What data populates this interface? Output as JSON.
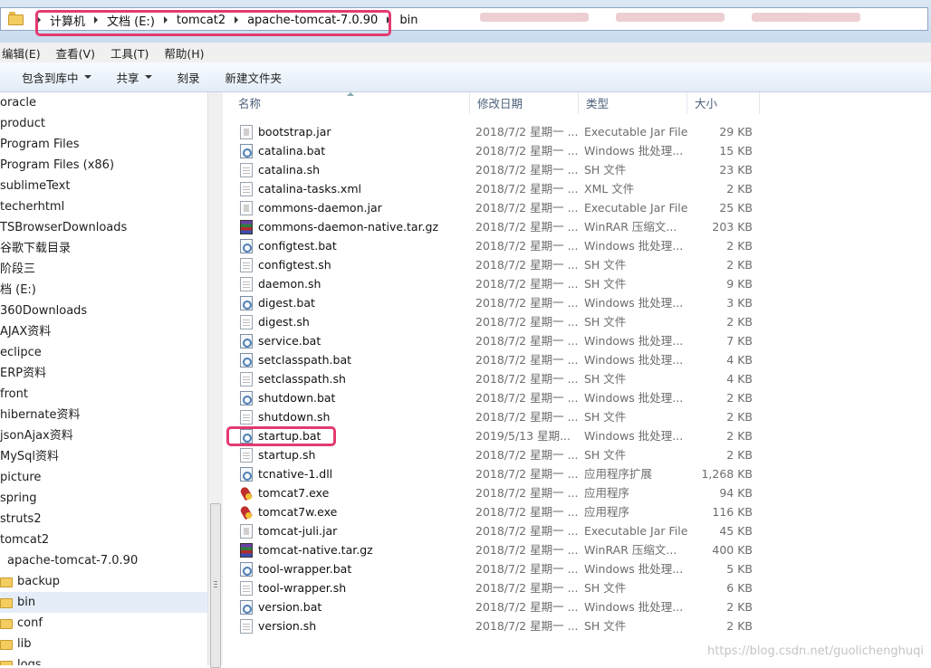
{
  "address": {
    "crumbs": [
      "计算机",
      "文档 (E:)",
      "tomcat2",
      "apache-tomcat-7.0.90",
      "bin"
    ]
  },
  "menu": [
    "编辑(E)",
    "查看(V)",
    "工具(T)",
    "帮助(H)"
  ],
  "toolbar": {
    "include_library": "包含到库中",
    "share": "共享",
    "burn": "刻录",
    "new_folder": "新建文件夹"
  },
  "nav": [
    {
      "label": "oracle",
      "indent": 0,
      "folder": false
    },
    {
      "label": "product",
      "indent": 0,
      "folder": false
    },
    {
      "label": "Program Files",
      "indent": 0,
      "folder": false
    },
    {
      "label": "Program Files (x86)",
      "indent": 0,
      "folder": false
    },
    {
      "label": "sublimeText",
      "indent": 0,
      "folder": false
    },
    {
      "label": "techerhtml",
      "indent": 0,
      "folder": false
    },
    {
      "label": "TSBrowserDownloads",
      "indent": 0,
      "folder": false
    },
    {
      "label": "谷歌下载目录",
      "indent": 0,
      "folder": false
    },
    {
      "label": "阶段三",
      "indent": 0,
      "folder": false
    },
    {
      "label": "档 (E:)",
      "indent": 0,
      "folder": false
    },
    {
      "label": "360Downloads",
      "indent": 0,
      "folder": false
    },
    {
      "label": "AJAX资料",
      "indent": 0,
      "folder": false
    },
    {
      "label": "eclipce",
      "indent": 0,
      "folder": false
    },
    {
      "label": "ERP资料",
      "indent": 0,
      "folder": false
    },
    {
      "label": "front",
      "indent": 0,
      "folder": false
    },
    {
      "label": "hibernate资料",
      "indent": 0,
      "folder": false
    },
    {
      "label": "jsonAjax资料",
      "indent": 0,
      "folder": false
    },
    {
      "label": "MySql资料",
      "indent": 0,
      "folder": false
    },
    {
      "label": "picture",
      "indent": 0,
      "folder": false
    },
    {
      "label": "spring",
      "indent": 0,
      "folder": false
    },
    {
      "label": "struts2",
      "indent": 0,
      "folder": false
    },
    {
      "label": "tomcat2",
      "indent": 0,
      "folder": false
    },
    {
      "label": "apache-tomcat-7.0.90",
      "indent": 1,
      "folder": false
    },
    {
      "label": "backup",
      "indent": 2,
      "folder": true
    },
    {
      "label": "bin",
      "indent": 2,
      "folder": true,
      "selected": true
    },
    {
      "label": "conf",
      "indent": 2,
      "folder": true
    },
    {
      "label": "lib",
      "indent": 2,
      "folder": true
    },
    {
      "label": "logs",
      "indent": 2,
      "folder": true
    }
  ],
  "columns": {
    "name": "名称",
    "date": "修改日期",
    "type": "类型",
    "size": "大小"
  },
  "files": [
    {
      "name": "bootstrap.jar",
      "date": "2018/7/2 星期一 ...",
      "type": "Executable Jar File",
      "size": "29 KB",
      "icon": "jar-icon"
    },
    {
      "name": "catalina.bat",
      "date": "2018/7/2 星期一 ...",
      "type": "Windows 批处理...",
      "size": "15 KB",
      "icon": "batch-icon"
    },
    {
      "name": "catalina.sh",
      "date": "2018/7/2 星期一 ...",
      "type": "SH 文件",
      "size": "23 KB",
      "icon": "file-icon"
    },
    {
      "name": "catalina-tasks.xml",
      "date": "2018/7/2 星期一 ...",
      "type": "XML 文件",
      "size": "2 KB",
      "icon": "file-icon"
    },
    {
      "name": "commons-daemon.jar",
      "date": "2018/7/2 星期一 ...",
      "type": "Executable Jar File",
      "size": "25 KB",
      "icon": "jar-icon"
    },
    {
      "name": "commons-daemon-native.tar.gz",
      "date": "2018/7/2 星期一 ...",
      "type": "WinRAR 压缩文...",
      "size": "203 KB",
      "icon": "winrar-icon"
    },
    {
      "name": "configtest.bat",
      "date": "2018/7/2 星期一 ...",
      "type": "Windows 批处理...",
      "size": "2 KB",
      "icon": "batch-icon"
    },
    {
      "name": "configtest.sh",
      "date": "2018/7/2 星期一 ...",
      "type": "SH 文件",
      "size": "2 KB",
      "icon": "file-icon"
    },
    {
      "name": "daemon.sh",
      "date": "2018/7/2 星期一 ...",
      "type": "SH 文件",
      "size": "9 KB",
      "icon": "file-icon"
    },
    {
      "name": "digest.bat",
      "date": "2018/7/2 星期一 ...",
      "type": "Windows 批处理...",
      "size": "3 KB",
      "icon": "batch-icon"
    },
    {
      "name": "digest.sh",
      "date": "2018/7/2 星期一 ...",
      "type": "SH 文件",
      "size": "2 KB",
      "icon": "file-icon"
    },
    {
      "name": "service.bat",
      "date": "2018/7/2 星期一 ...",
      "type": "Windows 批处理...",
      "size": "7 KB",
      "icon": "batch-icon"
    },
    {
      "name": "setclasspath.bat",
      "date": "2018/7/2 星期一 ...",
      "type": "Windows 批处理...",
      "size": "4 KB",
      "icon": "batch-icon"
    },
    {
      "name": "setclasspath.sh",
      "date": "2018/7/2 星期一 ...",
      "type": "SH 文件",
      "size": "4 KB",
      "icon": "file-icon"
    },
    {
      "name": "shutdown.bat",
      "date": "2018/7/2 星期一 ...",
      "type": "Windows 批处理...",
      "size": "2 KB",
      "icon": "batch-icon"
    },
    {
      "name": "shutdown.sh",
      "date": "2018/7/2 星期一 ...",
      "type": "SH 文件",
      "size": "2 KB",
      "icon": "file-icon"
    },
    {
      "name": "startup.bat",
      "date": "2019/5/13 星期...",
      "type": "Windows 批处理...",
      "size": "2 KB",
      "icon": "batch-icon",
      "highlight": true
    },
    {
      "name": "startup.sh",
      "date": "2018/7/2 星期一 ...",
      "type": "SH 文件",
      "size": "2 KB",
      "icon": "file-icon"
    },
    {
      "name": "tcnative-1.dll",
      "date": "2018/7/2 星期一 ...",
      "type": "应用程序扩展",
      "size": "1,268 KB",
      "icon": "dll-icon"
    },
    {
      "name": "tomcat7.exe",
      "date": "2018/7/2 星期一 ...",
      "type": "应用程序",
      "size": "94 KB",
      "icon": "tomcat-icon"
    },
    {
      "name": "tomcat7w.exe",
      "date": "2018/7/2 星期一 ...",
      "type": "应用程序",
      "size": "116 KB",
      "icon": "tomcat-icon"
    },
    {
      "name": "tomcat-juli.jar",
      "date": "2018/7/2 星期一 ...",
      "type": "Executable Jar File",
      "size": "45 KB",
      "icon": "jar-icon"
    },
    {
      "name": "tomcat-native.tar.gz",
      "date": "2018/7/2 星期一 ...",
      "type": "WinRAR 压缩文...",
      "size": "400 KB",
      "icon": "winrar-icon"
    },
    {
      "name": "tool-wrapper.bat",
      "date": "2018/7/2 星期一 ...",
      "type": "Windows 批处理...",
      "size": "5 KB",
      "icon": "batch-icon"
    },
    {
      "name": "tool-wrapper.sh",
      "date": "2018/7/2 星期一 ...",
      "type": "SH 文件",
      "size": "6 KB",
      "icon": "file-icon"
    },
    {
      "name": "version.bat",
      "date": "2018/7/2 星期一 ...",
      "type": "Windows 批处理...",
      "size": "2 KB",
      "icon": "batch-icon"
    },
    {
      "name": "version.sh",
      "date": "2018/7/2 星期一 ...",
      "type": "SH 文件",
      "size": "2 KB",
      "icon": "file-icon"
    }
  ],
  "watermark": "https://blog.csdn.net/guolichenghuqi",
  "colors": {
    "highlight": "#e33a6f",
    "selected_bg": "#e5eef8"
  }
}
